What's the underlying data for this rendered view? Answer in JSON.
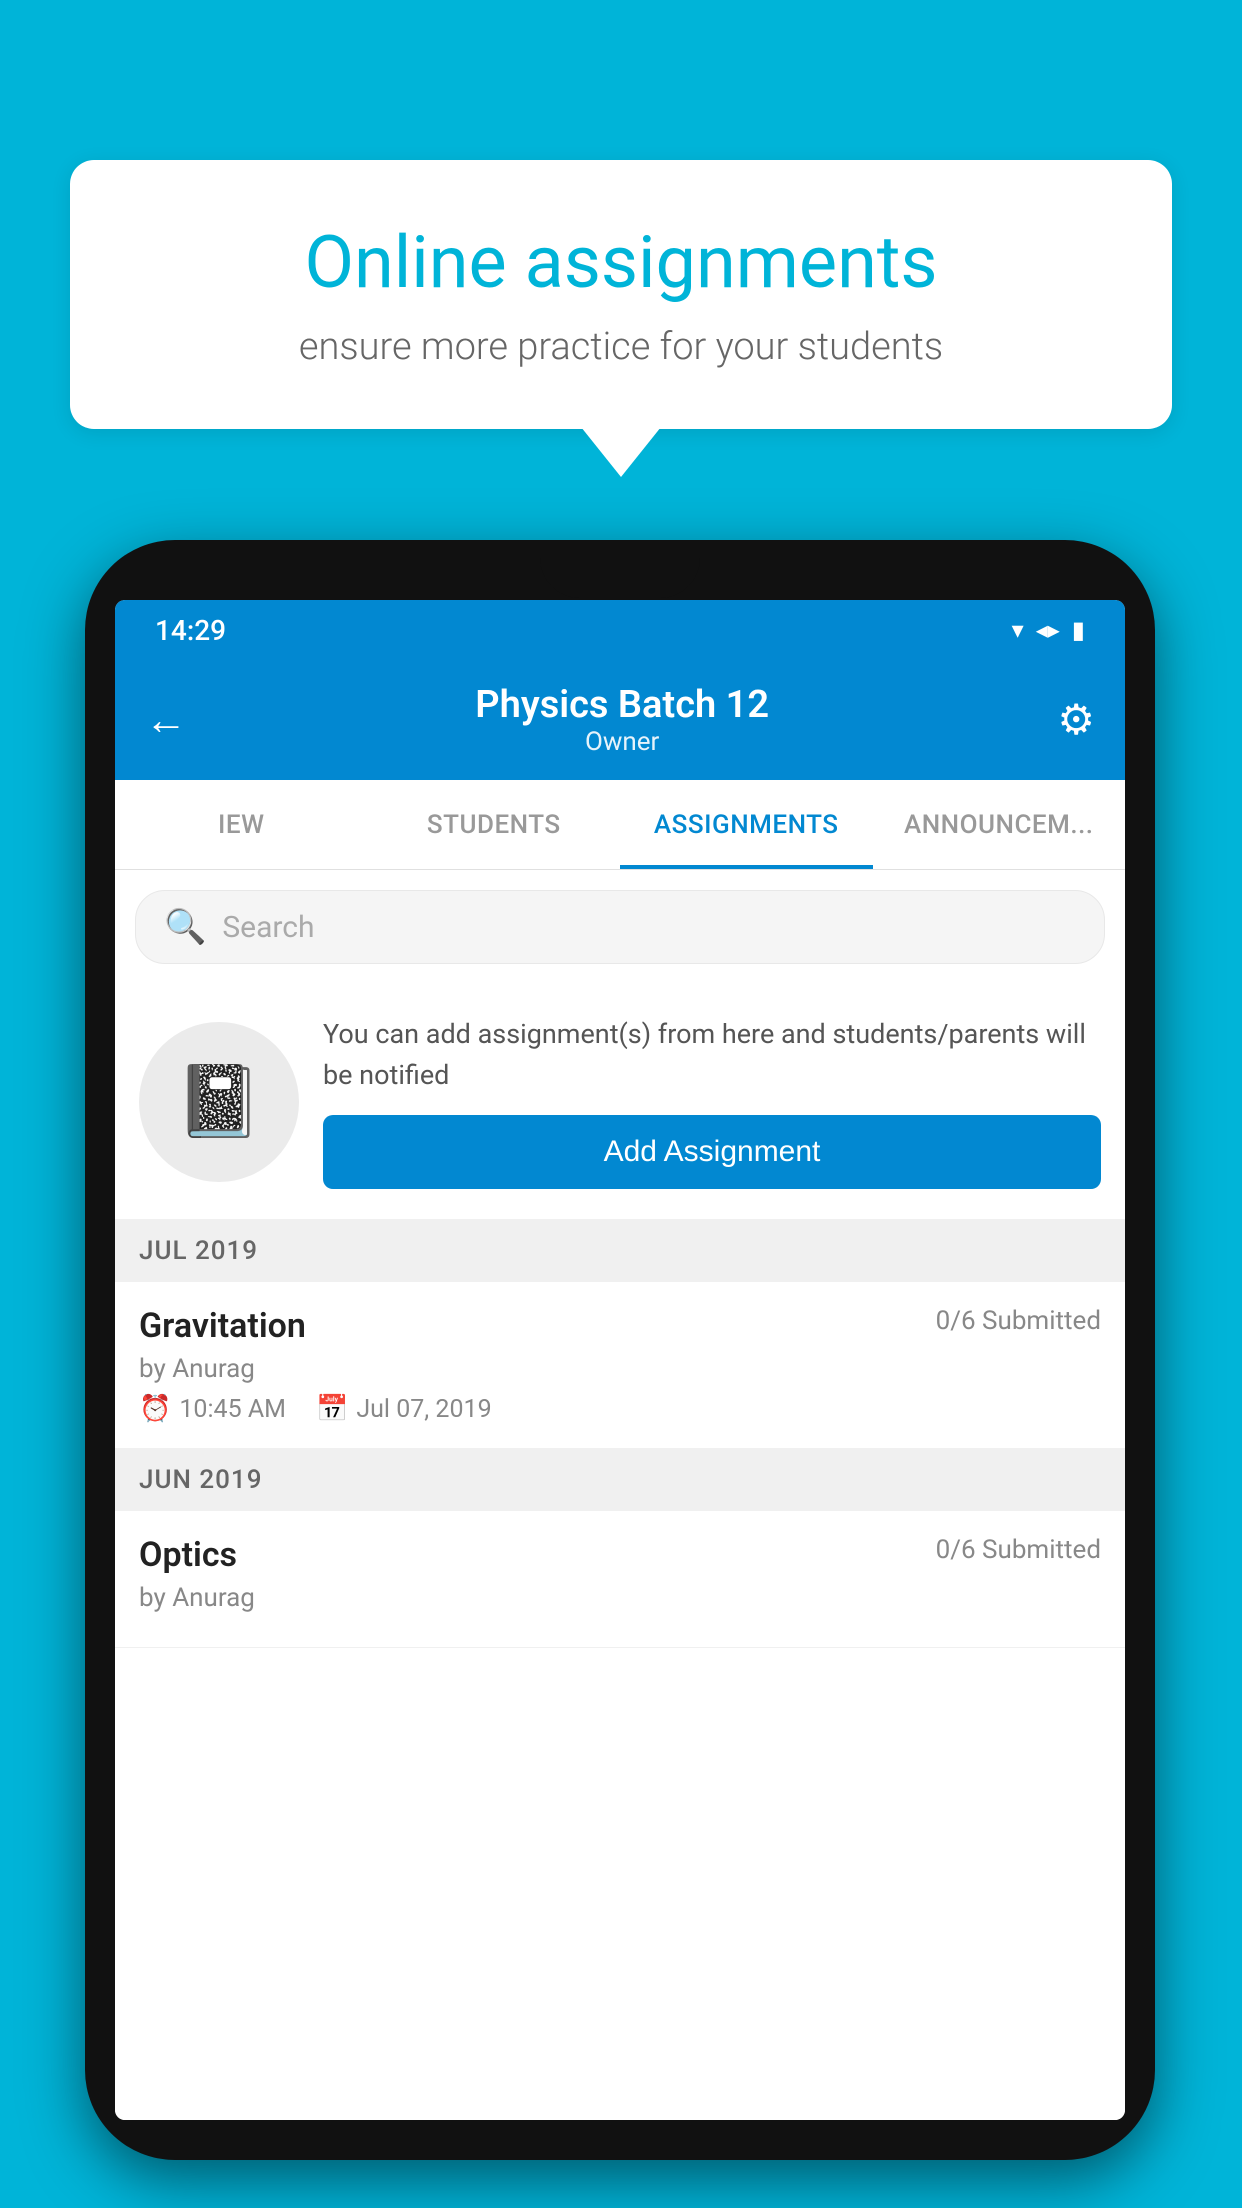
{
  "background_color": "#00b4d8",
  "speech_bubble": {
    "title": "Online assignments",
    "subtitle": "ensure more practice for your students"
  },
  "status_bar": {
    "time": "14:29",
    "wifi_icon": "▲",
    "signal_icon": "▲",
    "battery_icon": "▮"
  },
  "header": {
    "title": "Physics Batch 12",
    "subtitle": "Owner",
    "back_icon": "←",
    "settings_icon": "⚙"
  },
  "tabs": [
    {
      "label": "IEW",
      "active": false
    },
    {
      "label": "STUDENTS",
      "active": false
    },
    {
      "label": "ASSIGNMENTS",
      "active": true
    },
    {
      "label": "ANNOUNCEM...",
      "active": false
    }
  ],
  "search": {
    "placeholder": "Search"
  },
  "promo_card": {
    "icon": "📓",
    "description": "You can add assignment(s) from here and students/parents will be notified",
    "button_label": "Add Assignment"
  },
  "sections": [
    {
      "label": "JUL 2019",
      "assignments": [
        {
          "name": "Gravitation",
          "submitted": "0/6 Submitted",
          "by": "by Anurag",
          "time": "10:45 AM",
          "date": "Jul 07, 2019"
        }
      ]
    },
    {
      "label": "JUN 2019",
      "assignments": [
        {
          "name": "Optics",
          "submitted": "0/6 Submitted",
          "by": "by Anurag",
          "time": "",
          "date": ""
        }
      ]
    }
  ]
}
